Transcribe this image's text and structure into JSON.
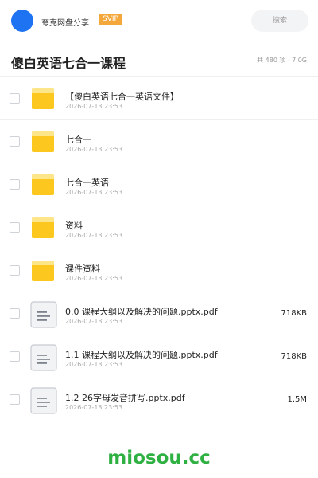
{
  "header": {
    "brand": "夸克网盘分享",
    "badge": "SVIP",
    "search_placeholder": "搜索"
  },
  "folder": {
    "title": "傻白英语七合一课程",
    "summary": "共 480 项 · 7.0G"
  },
  "files": [
    {
      "type": "folder",
      "name": "【傻白英语七合一英语文件】",
      "date": "2026-07-13 23:53",
      "size": ""
    },
    {
      "type": "folder",
      "name": "七合一",
      "date": "2026-07-13 23:53",
      "size": ""
    },
    {
      "type": "folder",
      "name": "七合一英语",
      "date": "2026-07-13 23:53",
      "size": ""
    },
    {
      "type": "folder",
      "name": "资料",
      "date": "2026-07-13 23:53",
      "size": ""
    },
    {
      "type": "folder",
      "name": "课件资料",
      "date": "2026-07-13 23:53",
      "size": ""
    },
    {
      "type": "document",
      "name": "0.0 课程大纲以及解决的问题.pptx.pdf",
      "date": "2026-07-13 23:53",
      "size": "718KB"
    },
    {
      "type": "document",
      "name": "1.1 课程大纲以及解决的问题.pptx.pdf",
      "date": "2026-07-13 23:53",
      "size": "718KB"
    },
    {
      "type": "document",
      "name": "1.2 26字母发音拼写.pptx.pdf",
      "date": "2026-07-13 23:53",
      "size": "1.5M"
    }
  ],
  "icons": {
    "folder": "folder-icon",
    "document": "document-icon"
  },
  "colors": {
    "avatar": "#1e73f2",
    "badge": "#f4a73a",
    "folder": "#fcc71f",
    "watermark": "#2fb043"
  },
  "watermark": "miosou.cc"
}
